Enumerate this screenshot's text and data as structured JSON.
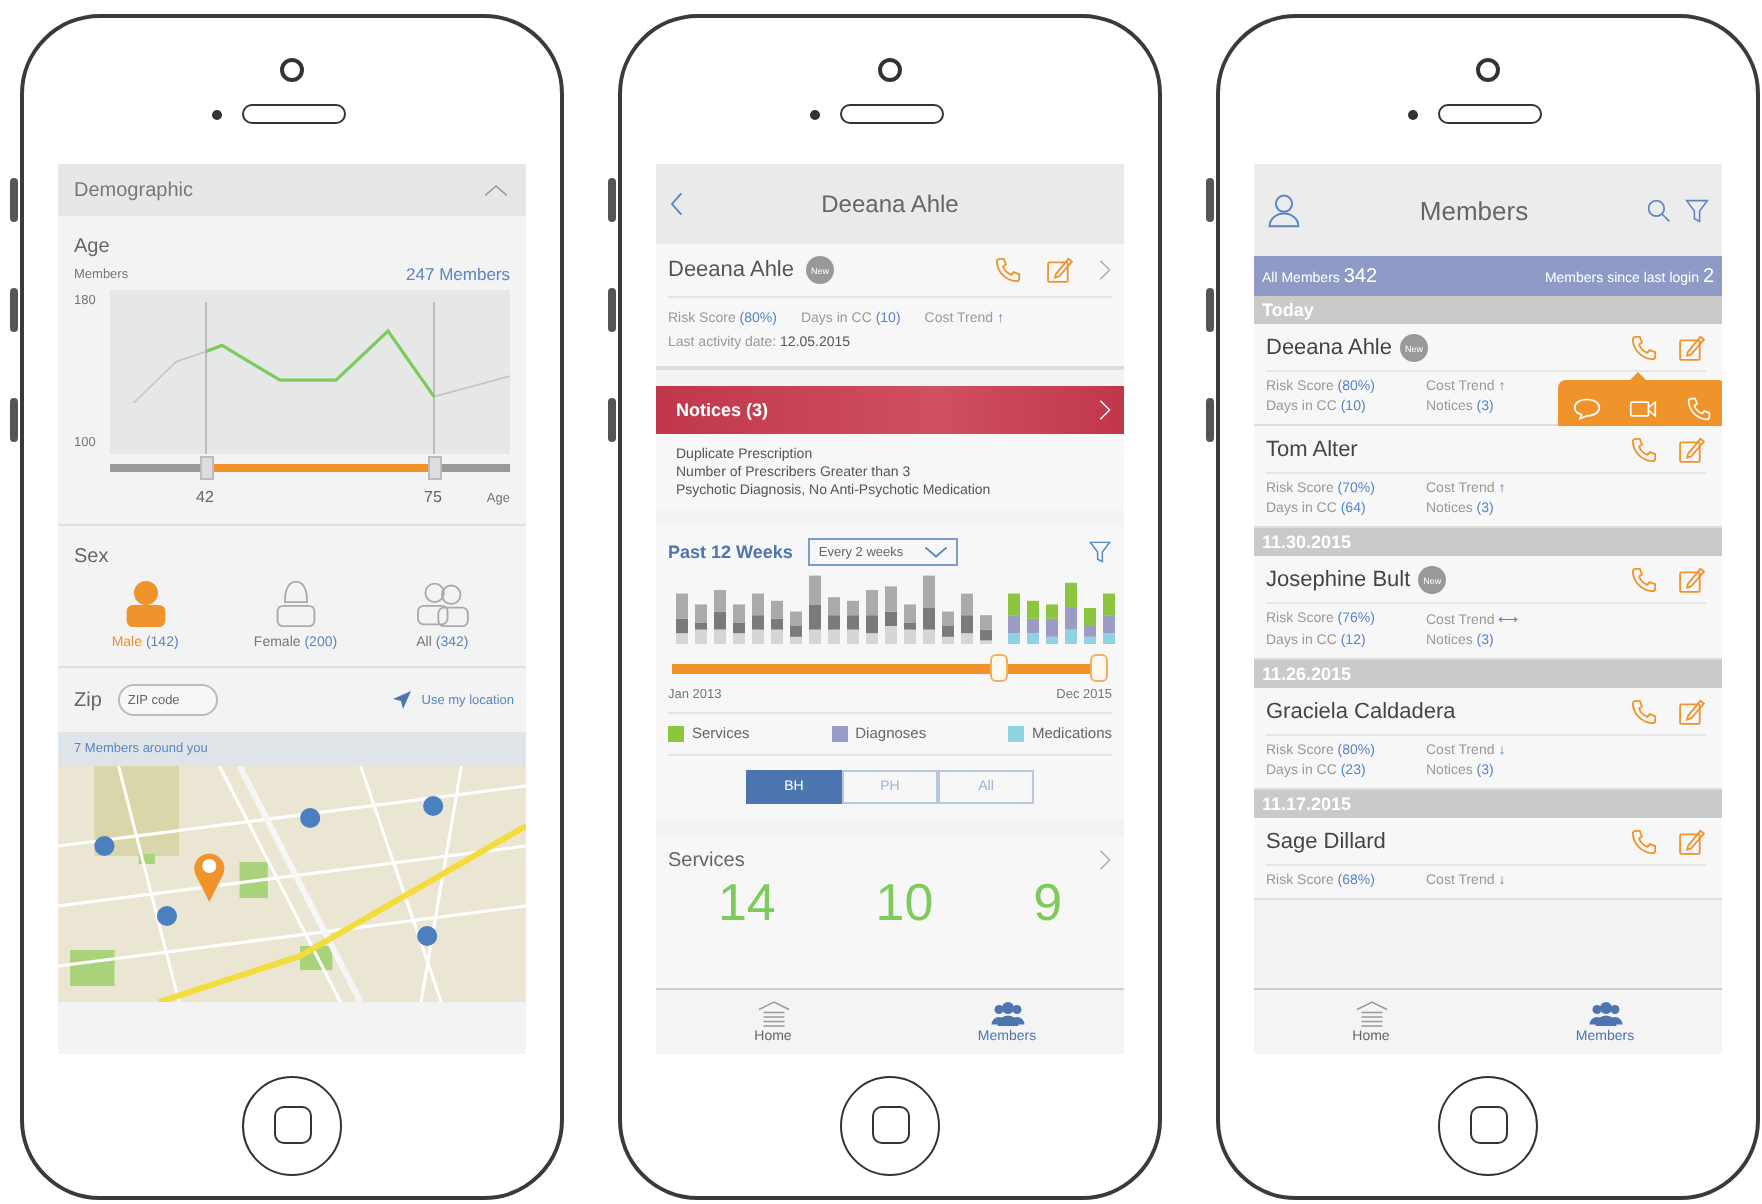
{
  "demographic_screen": {
    "header": {
      "title": "Demographic",
      "expanded": true
    },
    "age": {
      "label": "Age",
      "axis_label": "Members",
      "count": "247 Members",
      "y_max": "180",
      "y_min": "100",
      "range_low": "42",
      "range_high": "75",
      "x_label": "Age"
    },
    "sex": {
      "label": "Sex",
      "options": [
        {
          "kind": "male",
          "label": "Male",
          "count": "(142)",
          "selected": true
        },
        {
          "kind": "female",
          "label": "Female",
          "count": "(200)",
          "selected": false
        },
        {
          "kind": "all",
          "label": "All",
          "count": "(342)",
          "selected": false
        }
      ]
    },
    "zip": {
      "label": "Zip",
      "placeholder": "ZIP code",
      "location_link": "Use my location",
      "map_caption": "7 Members around you"
    }
  },
  "member_detail_screen": {
    "title": "Deeana Ahle",
    "name": "Deeana Ahle",
    "badge": "New",
    "stats": [
      {
        "label": "Risk Score",
        "value": "(80%)"
      },
      {
        "label": "Days in CC",
        "value": "(10)"
      },
      {
        "label": "Cost Trend",
        "value": "↑"
      }
    ],
    "last_activity": {
      "label": "Last activity date:",
      "value": "12.05.2015"
    },
    "notices": {
      "title": "Notices (3)",
      "items": [
        "Duplicate Prescription",
        "Number of Prescribers Greater than 3",
        "Psychotic Diagnosis, No Anti-Psychotic Medication"
      ]
    },
    "history": {
      "title": "Past 12 Weeks",
      "interval": "Every 2 weeks",
      "start": "Jan 2013",
      "end": "Dec 2015",
      "legend": [
        {
          "label": "Services",
          "color": "#8cc63f"
        },
        {
          "label": "Diagnoses",
          "color": "#9b9cc6"
        },
        {
          "label": "Medications",
          "color": "#8fd3e1"
        }
      ],
      "segments": [
        {
          "label": "BH",
          "selected": true
        },
        {
          "label": "PH",
          "selected": false
        },
        {
          "label": "All",
          "selected": false
        }
      ]
    },
    "services": {
      "title": "Services",
      "numbers": [
        "14",
        "10",
        "9"
      ]
    },
    "tab_bar": [
      {
        "kind": "home",
        "label": "Home",
        "selected": false
      },
      {
        "kind": "members",
        "label": "Members",
        "selected": true
      }
    ]
  },
  "members_screen": {
    "title": "Members",
    "summary": {
      "all_label": "All Members",
      "all_count": "342",
      "new_label": "Members since last login",
      "new_count": "2"
    },
    "groups": [
      {
        "date": "Today",
        "members": [
          {
            "name": "Deeana Ahle",
            "badge": "New",
            "contact_menu_open": true,
            "stats": [
              {
                "label": "Risk Score",
                "value": "(80%)"
              },
              {
                "label": "Cost Trend",
                "value": "↑"
              },
              {
                "label": "Days in CC",
                "value": "(10)"
              },
              {
                "label": "Notices",
                "value": "(3)"
              }
            ]
          },
          {
            "name": "Tom Alter",
            "contact_menu_open": false,
            "stats": [
              {
                "label": "Risk Score",
                "value": "(70%)"
              },
              {
                "label": "Cost Trend",
                "value": "↑"
              },
              {
                "label": "Days in CC",
                "value": "(64)"
              },
              {
                "label": "Notices",
                "value": "(3)"
              }
            ]
          }
        ]
      },
      {
        "date": "11.30.2015",
        "members": [
          {
            "name": "Josephine Bult",
            "badge": "New",
            "contact_menu_open": false,
            "stats": [
              {
                "label": "Risk Score",
                "value": "(76%)"
              },
              {
                "label": "Cost Trend",
                "value": "⟷"
              },
              {
                "label": "Days in CC",
                "value": "(12)"
              },
              {
                "label": "Notices",
                "value": "(3)"
              }
            ]
          }
        ]
      },
      {
        "date": "11.26.2015",
        "members": [
          {
            "name": "Graciela Caldadera",
            "contact_menu_open": false,
            "stats": [
              {
                "label": "Risk Score",
                "value": "(80%)"
              },
              {
                "label": "Cost Trend",
                "value": "↓"
              },
              {
                "label": "Days in CC",
                "value": "(23)"
              },
              {
                "label": "Notices",
                "value": "(3)"
              }
            ]
          }
        ]
      },
      {
        "date": "11.17.2015",
        "members": [
          {
            "name": "Sage Dillard",
            "contact_menu_open": false,
            "stats": [
              {
                "label": "Risk Score",
                "value": "(68%)"
              },
              {
                "label": "Cost Trend",
                "value": "↓"
              }
            ]
          }
        ]
      }
    ],
    "tab_bar": [
      {
        "kind": "home",
        "label": "Home",
        "selected": false
      },
      {
        "kind": "members",
        "label": "Members",
        "selected": true
      }
    ]
  }
}
